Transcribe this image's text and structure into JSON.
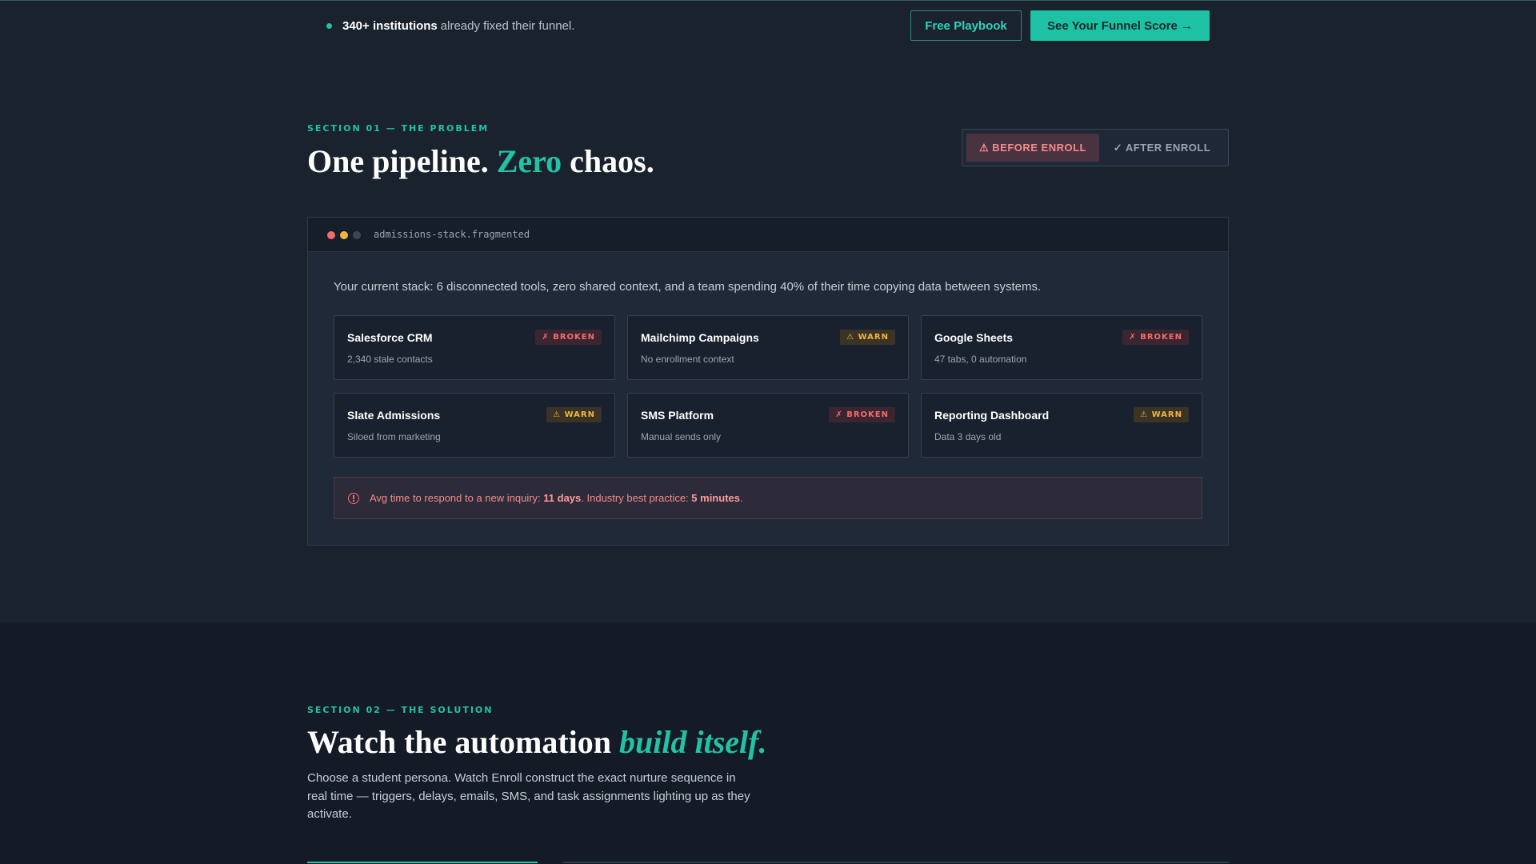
{
  "topbar": {
    "stat_strong": "340+ institutions",
    "stat_rest": "already fixed their funnel.",
    "free_playbook": "Free Playbook",
    "funnel_score": "See Your Funnel Score →"
  },
  "section1": {
    "label": "SECTION 01 — THE PROBLEM",
    "title_a": "One pipeline. ",
    "title_accent": "Zero",
    "title_b": " chaos.",
    "toggle_before": "⚠ BEFORE ENROLL",
    "toggle_after": "✓ AFTER ENROLL",
    "panel_file": "admissions-stack.fragmented",
    "panel_desc": "Your current stack: 6 disconnected tools, zero shared context, and a team spending 40% of their time copying data between systems.",
    "tools": [
      {
        "name": "Salesforce CRM",
        "sub": "2,340 stale contacts",
        "badge": "✗ BROKEN",
        "status": "broken"
      },
      {
        "name": "Mailchimp Campaigns",
        "sub": "No enrollment context",
        "badge": "⚠ WARN",
        "status": "warn"
      },
      {
        "name": "Google Sheets",
        "sub": "47 tabs, 0 automation",
        "badge": "✗ BROKEN",
        "status": "broken"
      },
      {
        "name": "Slate Admissions",
        "sub": "Siloed from marketing",
        "badge": "⚠ WARN",
        "status": "warn"
      },
      {
        "name": "SMS Platform",
        "sub": "Manual sends only",
        "badge": "✗ BROKEN",
        "status": "broken"
      },
      {
        "name": "Reporting Dashboard",
        "sub": "Data 3 days old",
        "badge": "⚠ WARN",
        "status": "warn"
      }
    ],
    "alert_a": "Avg time to respond to a new inquiry: ",
    "alert_b1": "11 days",
    "alert_c": ". Industry best practice: ",
    "alert_b2": "5 minutes",
    "alert_d": "."
  },
  "section2": {
    "label": "SECTION 02 — THE SOLUTION",
    "title_a": "Watch the automation ",
    "title_accent": "build itself.",
    "desc": "Choose a student persona. Watch Enroll construct the exact nurture sequence in real time — triggers, delays, emails, SMS, and task assignments lighting up as they activate."
  },
  "colors": {
    "accent": "#21c2a6",
    "broken": "#f26d6d",
    "warn": "#f2b53c",
    "background": "#1a222e"
  }
}
